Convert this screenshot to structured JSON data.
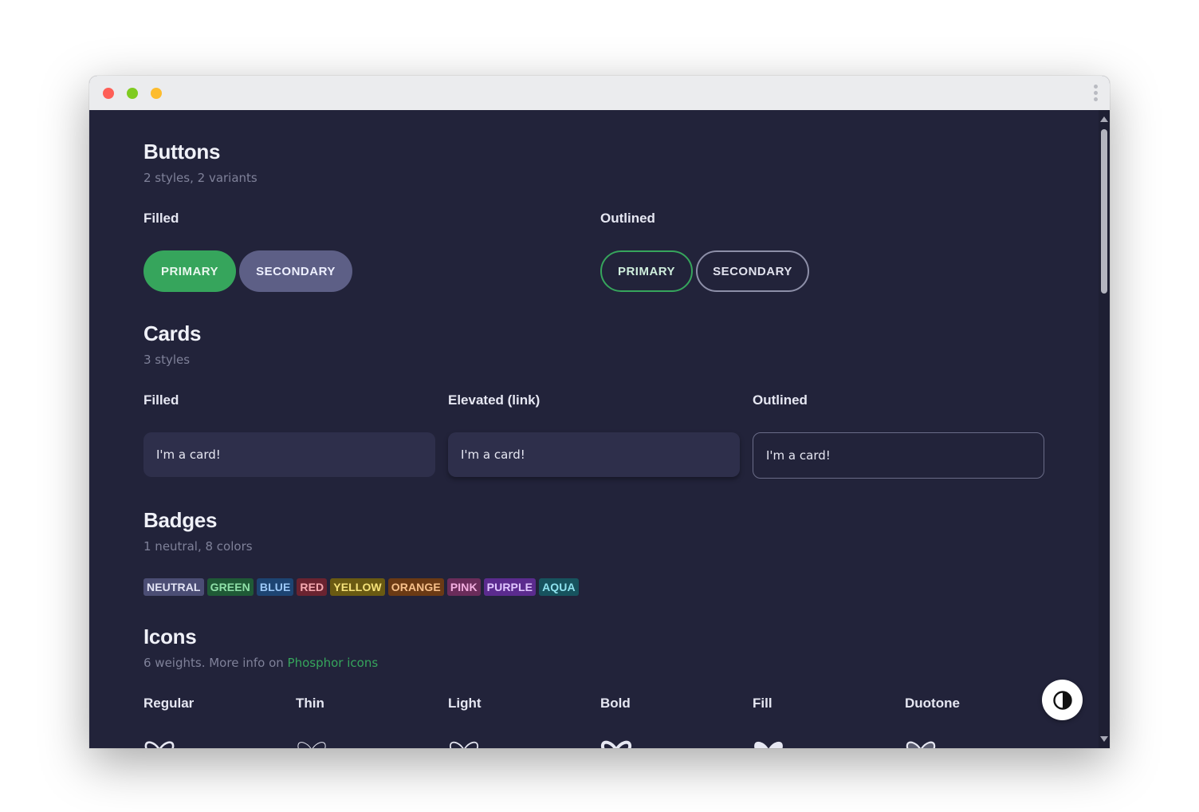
{
  "buttons": {
    "title": "Buttons",
    "subtitle": "2 styles, 2 variants",
    "filled_label": "Filled",
    "outlined_label": "Outlined",
    "primary": "PRIMARY",
    "secondary": "SECONDARY"
  },
  "cards": {
    "title": "Cards",
    "subtitle": "3 styles",
    "filled_label": "Filled",
    "elevated_label": "Elevated (link)",
    "outlined_label": "Outlined",
    "card_text": "I'm a card!"
  },
  "badges": {
    "title": "Badges",
    "subtitle": "1 neutral, 8 colors",
    "items": [
      {
        "label": "NEUTRAL",
        "bg": "#4b4d74",
        "fg": "#e3e4f5"
      },
      {
        "label": "GREEN",
        "bg": "#1f5a36",
        "fg": "#8fe0a8"
      },
      {
        "label": "BLUE",
        "bg": "#1d4472",
        "fg": "#9cc8f7"
      },
      {
        "label": "RED",
        "bg": "#6a2330",
        "fg": "#f6a9b0"
      },
      {
        "label": "YELLOW",
        "bg": "#6a5a12",
        "fg": "#f5e27a"
      },
      {
        "label": "ORANGE",
        "bg": "#6b3a14",
        "fg": "#f7c08a"
      },
      {
        "label": "PINK",
        "bg": "#6a2c5a",
        "fg": "#f3aee0"
      },
      {
        "label": "PURPLE",
        "bg": "#5b2b8e",
        "fg": "#e0c6ff"
      },
      {
        "label": "AQUA",
        "bg": "#17535e",
        "fg": "#8fe3ef"
      }
    ]
  },
  "icons": {
    "title": "Icons",
    "subtitle_prefix": "6 weights. More info on ",
    "link_text": "Phosphor icons",
    "weights": [
      "Regular",
      "Thin",
      "Light",
      "Bold",
      "Fill",
      "Duotone"
    ],
    "icon_name": "butterfly-icon"
  },
  "theme_toggle": {
    "icon": "contrast-icon"
  },
  "colors": {
    "background": "#22233a",
    "primary": "#36a55c",
    "secondary": "#5d5f86",
    "card": "#2e2f4b"
  }
}
